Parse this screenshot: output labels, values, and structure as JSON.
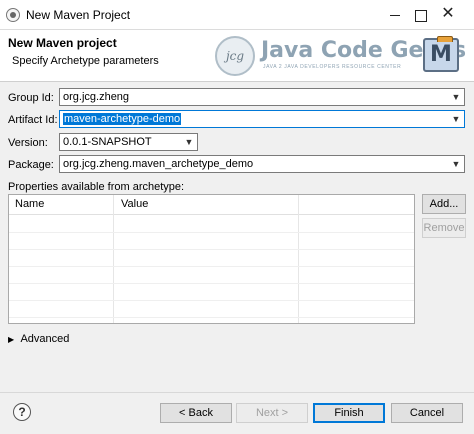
{
  "window": {
    "title": "New Maven Project",
    "icon": "eclipse-icon",
    "controls": [
      "minimize-icon",
      "maximize-icon",
      "close-icon"
    ],
    "close_glyph": "✕"
  },
  "header": {
    "title": "New Maven project",
    "subtitle": "Specify Archetype parameters",
    "logo_text": "Java Code Geeks",
    "logo_circle": "jcg",
    "logo_tagline": "JAVA 2 JAVA DEVELOPERS RESOURCE CENTER",
    "maven_icon_letter": "M"
  },
  "form": {
    "group_id": {
      "label": "Group Id:",
      "value": "org.jcg.zheng"
    },
    "artifact_id": {
      "label": "Artifact Id:",
      "value": "maven-archetype-demo"
    },
    "version": {
      "label": "Version:",
      "value": "0.0.1-SNAPSHOT"
    },
    "package": {
      "label": "Package:",
      "value": "org.jcg.zheng.maven_archetype_demo"
    },
    "chevron": "▼"
  },
  "properties": {
    "label": "Properties available from archetype:",
    "columns": [
      "Name",
      "Value"
    ],
    "rows": [],
    "add_label": "Add...",
    "remove_label": "Remove"
  },
  "advanced": {
    "label": "Advanced",
    "arrow": "▶"
  },
  "footer": {
    "help_glyph": "?",
    "back_label": "< Back",
    "next_label": "Next >",
    "finish_label": "Finish",
    "cancel_label": "Cancel"
  },
  "colors": {
    "accent": "#0078d7",
    "logo": "#8ea3b3"
  }
}
